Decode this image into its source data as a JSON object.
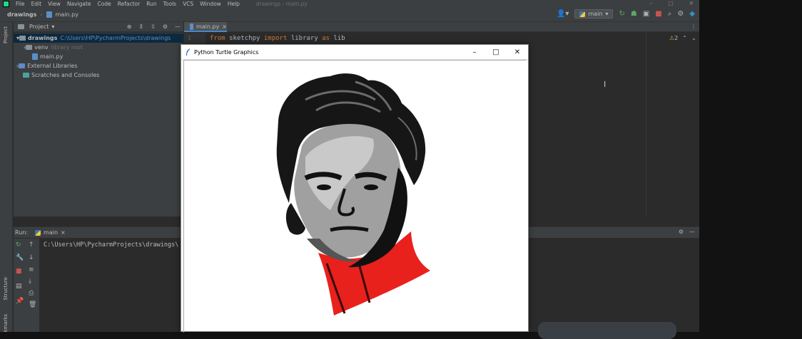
{
  "menu": {
    "items": [
      "File",
      "Edit",
      "View",
      "Navigate",
      "Code",
      "Refactor",
      "Run",
      "Tools",
      "VCS",
      "Window",
      "Help"
    ],
    "window_title": "drawings - main.py"
  },
  "breadcrumb": {
    "project": "drawings",
    "file": "main.py"
  },
  "toolbar": {
    "run_config": "main"
  },
  "project_panel": {
    "title": "Project",
    "tree": [
      {
        "name": "drawings",
        "extra": "C:\\Users\\HP\\PycharmProjects\\drawings"
      },
      {
        "name": "venv",
        "extra": "library root"
      },
      {
        "name": "main.py"
      },
      {
        "name": "External Libraries"
      },
      {
        "name": "Scratches and Consoles"
      }
    ]
  },
  "editor": {
    "tab": "main.py",
    "line_number": "1",
    "code": {
      "kw1": "from",
      "mod": "sketchpy",
      "kw2": "import",
      "name": "library",
      "kw3": "as",
      "alias": "lib"
    },
    "warnings": "2"
  },
  "side_strip": {
    "project": "Project",
    "structure": "Structure",
    "bookmarks": "Bookmarks"
  },
  "run_panel": {
    "label": "Run:",
    "tab": "main",
    "output": "C:\\Users\\HP\\PycharmProjects\\drawings\\"
  },
  "turtle_window": {
    "title": "Python Turtle Graphics"
  },
  "colors": {
    "accent": "#4a88c7",
    "jersey_red": "#e8211c",
    "kw": "#cc7832"
  }
}
